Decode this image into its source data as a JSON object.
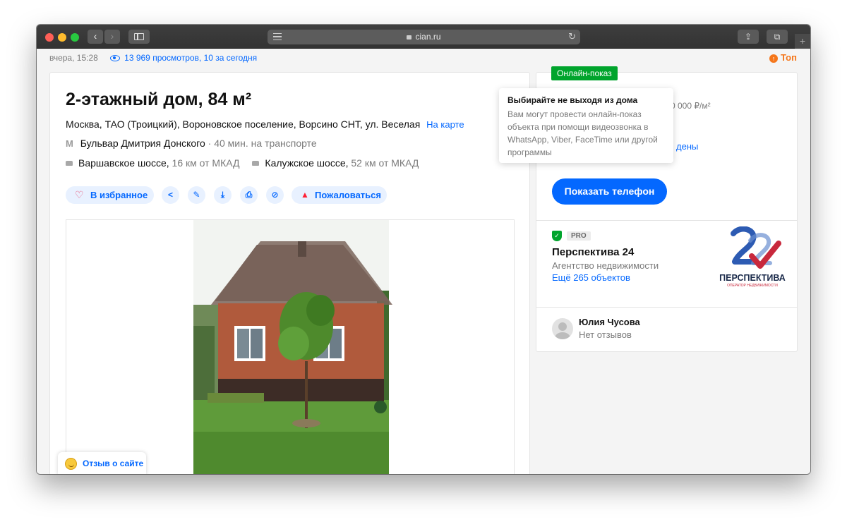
{
  "browser": {
    "url": "cian.ru",
    "back_symbol": "‹",
    "forward_symbol": "›",
    "reload_symbol": "↻",
    "share_symbol": "⇪",
    "tabs_symbol": "⧉",
    "newtab_symbol": "+"
  },
  "meta": {
    "date": "вчера, 15:28",
    "views": "13 969 просмотров, 10 за сегодня",
    "top_label": "Топ",
    "top_icon": "arrow-up-icon"
  },
  "listing": {
    "title": "2-этажный дом, 84 м²",
    "address": "Москва, ТАО (Троицкий), Вороновское поселение, Ворсино СНТ, ул. Веселая",
    "map_link": "На карте",
    "metro": {
      "symbol": "М",
      "station": "Бульвар Дмитрия Донского",
      "separator": "·",
      "travel": "40 мин. на транспорте"
    },
    "roads": [
      {
        "name": "Варшавское шоссе,",
        "distance": "16 км от МКАД"
      },
      {
        "name": "Калужское шоссе,",
        "distance": "52 км от МКАД"
      }
    ],
    "actions": {
      "favorite_label": "В избранное",
      "share_icon": "<",
      "edit_icon": "✎",
      "download_icon": "⤓",
      "print_icon": "⎙",
      "hide_icon": "⊘",
      "report_label": "Пожаловаться"
    }
  },
  "feedback": {
    "label": "Отзыв о сайте"
  },
  "sidebar": {
    "online_badge": "Онлайн-показ",
    "price_partial": "0 000 ₽/м²",
    "partial_word": "дены",
    "tooltip": {
      "title": "Выбирайте не выходя из дома",
      "body": "Вам могут провести онлайн-показ объекта при помощи видеозвонка в WhatsApp, Viber, FaceTime или другой программы"
    },
    "phone_button": "Показать телефон",
    "agency": {
      "verified_icon": "✓",
      "pro_label": "PRO",
      "name": "Перспектива 24",
      "type": "Агентство недвижимости",
      "more_link": "Ещё 265 объектов",
      "logo_text": "ПЕРСПЕКТИВА",
      "logo_subtext": "ОПЕРАТОР НЕДВИЖИМОСТИ"
    },
    "agent": {
      "name": "Юлия Чусова",
      "reviews": "Нет отзывов"
    }
  },
  "colors": {
    "accent": "#0468ff",
    "online_green": "#00a42c",
    "top_orange": "#f5761a",
    "logo_blue": "#2d5bb3",
    "logo_red": "#c8283c"
  }
}
